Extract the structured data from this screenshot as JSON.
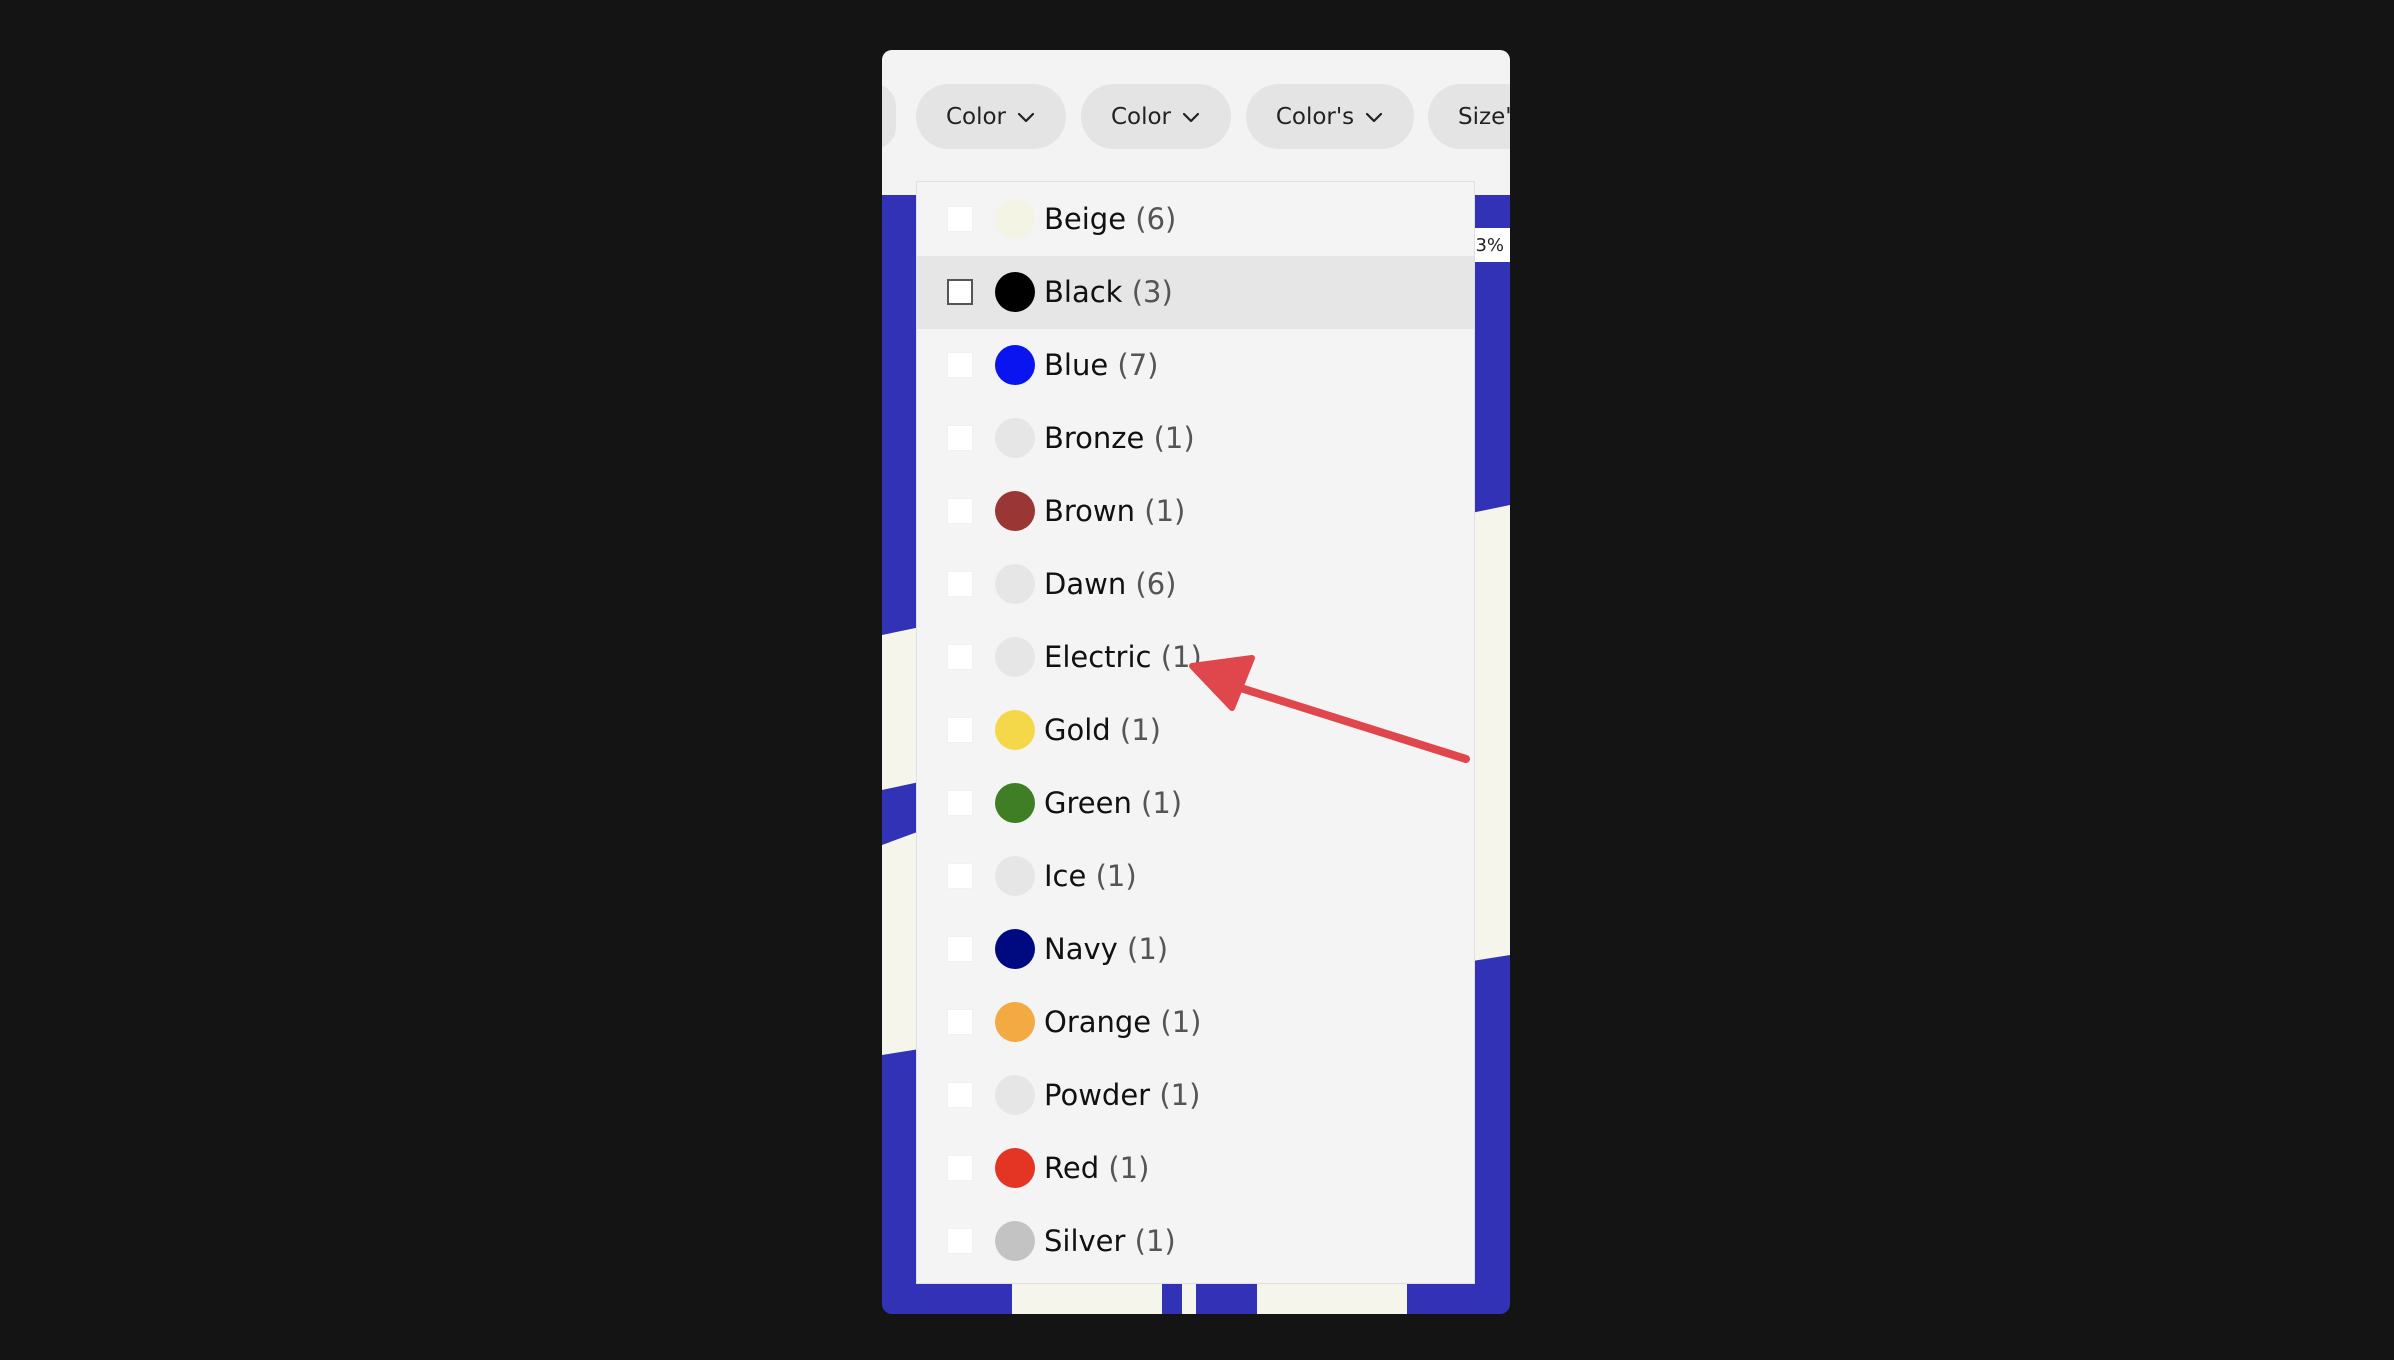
{
  "filters": [
    {
      "label": "Color"
    },
    {
      "label": "Color"
    },
    {
      "label": "Color's"
    },
    {
      "label": "Size'"
    }
  ],
  "badge": "3%",
  "colors": {
    "background": "#141414",
    "art_blue": "#3132b5",
    "art_cream": "#f6f5ec",
    "annotation": "#e0474c"
  },
  "dropdown": {
    "options": [
      {
        "name": "Beige",
        "count": "(6)",
        "swatch": "#f3f4e4",
        "hover": false
      },
      {
        "name": "Black",
        "count": "(3)",
        "swatch": "#000000",
        "hover": true
      },
      {
        "name": "Blue",
        "count": "(7)",
        "swatch": "#0a14f0",
        "hover": false
      },
      {
        "name": "Bronze",
        "count": "(1)",
        "swatch": "#e6e6e6",
        "hover": false
      },
      {
        "name": "Brown",
        "count": "(1)",
        "swatch": "#9a3633",
        "hover": false
      },
      {
        "name": "Dawn",
        "count": "(6)",
        "swatch": "#e6e6e6",
        "hover": false
      },
      {
        "name": "Electric",
        "count": "(1)",
        "swatch": "#e6e6e6",
        "hover": false
      },
      {
        "name": "Gold",
        "count": "(1)",
        "swatch": "#f5d84a",
        "hover": false
      },
      {
        "name": "Green",
        "count": "(1)",
        "swatch": "#3f7e25",
        "hover": false
      },
      {
        "name": "Ice",
        "count": "(1)",
        "swatch": "#e6e6e6",
        "hover": false
      },
      {
        "name": "Navy",
        "count": "(1)",
        "swatch": "#000a80",
        "hover": false
      },
      {
        "name": "Orange",
        "count": "(1)",
        "swatch": "#f3aa42",
        "hover": false
      },
      {
        "name": "Powder",
        "count": "(1)",
        "swatch": "#e6e6e6",
        "hover": false
      },
      {
        "name": "Red",
        "count": "(1)",
        "swatch": "#e43524",
        "hover": false
      },
      {
        "name": "Silver",
        "count": "(1)",
        "swatch": "#c3c3c3",
        "hover": false
      }
    ]
  }
}
